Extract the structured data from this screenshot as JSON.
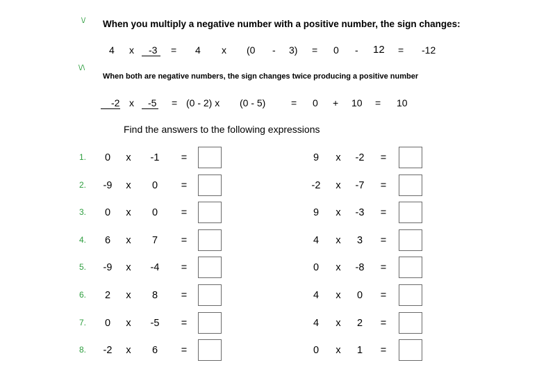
{
  "marks": {
    "first": "\\/",
    "second": "\\/\\"
  },
  "intro": {
    "heading1": "When you multiply a negative number with a positive number, the sign changes:",
    "example1": [
      "4",
      "x",
      "-3",
      "=",
      "4",
      "x",
      "(0",
      "-",
      "3)",
      "=",
      "0",
      "-",
      "12",
      "=",
      "-12"
    ],
    "heading2": "When both are negative numbers,  the sign changes twice producing a positive number",
    "example2": [
      "-2",
      "x",
      "-5",
      "=",
      "(0 - 2) x",
      "(0 - 5)",
      "=",
      "0",
      "+",
      "10",
      "=",
      "10"
    ],
    "instruction": "Find the answers to the following expressions"
  },
  "problems": [
    {
      "num": "1.",
      "left": [
        "0",
        "x",
        "-1",
        "="
      ],
      "right": [
        "9",
        "x",
        "-2",
        "="
      ]
    },
    {
      "num": "2.",
      "left": [
        "-9",
        "x",
        "0",
        "="
      ],
      "right": [
        "-2",
        "x",
        "-7",
        "="
      ]
    },
    {
      "num": "3.",
      "left": [
        "0",
        "x",
        "0",
        "="
      ],
      "right": [
        "9",
        "x",
        "-3",
        "="
      ]
    },
    {
      "num": "4.",
      "left": [
        "6",
        "x",
        "7",
        "="
      ],
      "right": [
        "4",
        "x",
        "3",
        "="
      ]
    },
    {
      "num": "5.",
      "left": [
        "-9",
        "x",
        "-4",
        "="
      ],
      "right": [
        "0",
        "x",
        "-8",
        "="
      ]
    },
    {
      "num": "6.",
      "left": [
        "2",
        "x",
        "8",
        "="
      ],
      "right": [
        "4",
        "x",
        "0",
        "="
      ]
    },
    {
      "num": "7.",
      "left": [
        "0",
        "x",
        "-5",
        "="
      ],
      "right": [
        "4",
        "x",
        "2",
        "="
      ]
    },
    {
      "num": "8.",
      "left": [
        "-2",
        "x",
        "6",
        "="
      ],
      "right": [
        "0",
        "x",
        "1",
        "="
      ]
    }
  ],
  "colors": {
    "row_number": "#2e9e3f",
    "box_border": "#6a6a6a"
  }
}
